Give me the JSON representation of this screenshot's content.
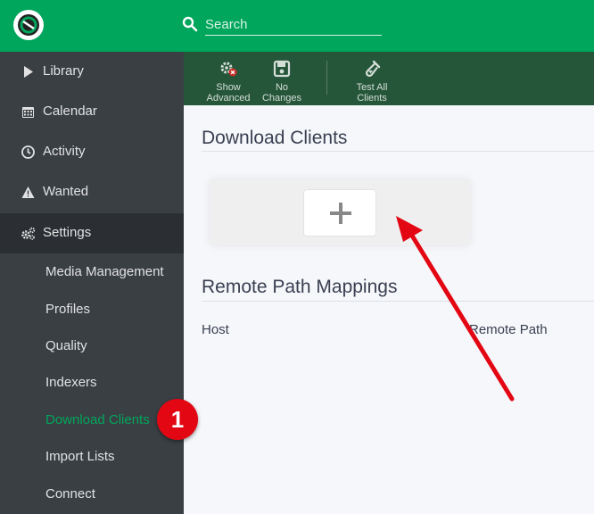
{
  "header": {
    "logo": "app-logo",
    "search_placeholder": "Search"
  },
  "sidebar": {
    "items": [
      {
        "label": "Library",
        "icon": "play-icon"
      },
      {
        "label": "Calendar",
        "icon": "calendar-icon"
      },
      {
        "label": "Activity",
        "icon": "clock-icon"
      },
      {
        "label": "Wanted",
        "icon": "warning-icon"
      },
      {
        "label": "Settings",
        "icon": "gears-icon"
      }
    ],
    "settings_items": [
      {
        "label": "Media Management"
      },
      {
        "label": "Profiles"
      },
      {
        "label": "Quality"
      },
      {
        "label": "Indexers"
      },
      {
        "label": "Download Clients"
      },
      {
        "label": "Import Lists"
      },
      {
        "label": "Connect"
      }
    ]
  },
  "toolbar": {
    "show_advanced": "Show\nAdvanced",
    "no_changes": "No\nChanges",
    "test_all_clients": "Test All\nClients"
  },
  "main": {
    "download_clients_title": "Download Clients",
    "remote_path_title": "Remote Path Mappings",
    "columns": [
      "Host",
      "Remote Path"
    ]
  },
  "annotation": {
    "badge_number": "1"
  },
  "colors": {
    "brand": "#00a65b",
    "toolbar": "#26563a",
    "sidebar": "#3a3f44",
    "annotation": "#e30613"
  }
}
